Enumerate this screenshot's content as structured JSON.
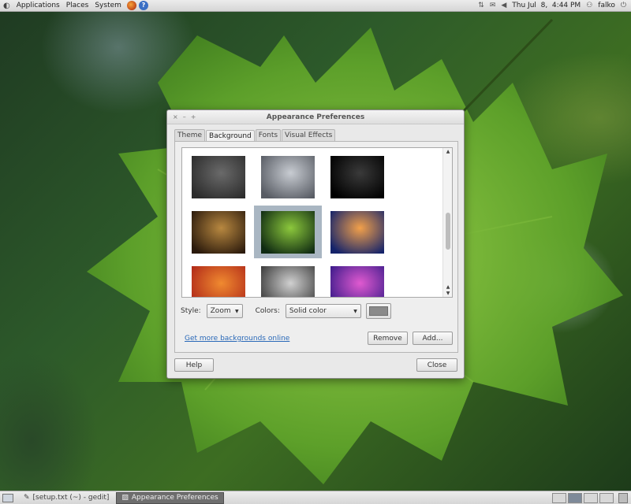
{
  "top_panel": {
    "menus": [
      "Applications",
      "Places",
      "System"
    ],
    "clock": "Thu Jul  8,  4:44 PM",
    "user": "falko",
    "icons": [
      "ubuntu-logo-icon",
      "firefox-icon",
      "help-icon",
      "network-icon",
      "mail-icon",
      "volume-icon",
      "power-icon"
    ]
  },
  "dialog": {
    "title": "Appearance Preferences",
    "window_buttons": [
      "×",
      "–",
      "+"
    ],
    "tabs": [
      "Theme",
      "Background",
      "Fonts",
      "Visual Effects"
    ],
    "active_tab": "Background",
    "backgrounds": [
      {
        "name": "dark-gray-wallpaper",
        "colors": [
          "#6a6a6a",
          "#2c2c2c"
        ]
      },
      {
        "name": "pebbles-wallpaper",
        "colors": [
          "#c8ccd2",
          "#585c64"
        ]
      },
      {
        "name": "white-flower-wallpaper",
        "colors": [
          "#3a3a3a",
          "#000000"
        ]
      },
      {
        "name": "autumn-leaves-wallpaper",
        "colors": [
          "#b88840",
          "#2b1a0c"
        ]
      },
      {
        "name": "green-leaf-wallpaper",
        "colors": [
          "#8cc83c",
          "#0f2a12"
        ],
        "selected": true
      },
      {
        "name": "pier-sunset-wallpaper",
        "colors": [
          "#f2a04a",
          "#14236a"
        ]
      },
      {
        "name": "orange-bokeh-wallpaper",
        "colors": [
          "#f08a30",
          "#b02818"
        ]
      },
      {
        "name": "gray-gradient-wallpaper",
        "colors": [
          "#d0d0d0",
          "#3a3a3a"
        ]
      },
      {
        "name": "purple-lights-wallpaper",
        "colors": [
          "#e05ad0",
          "#3a1a8a"
        ]
      }
    ],
    "style_label": "Style:",
    "style_value": "Zoom",
    "colors_label": "Colors:",
    "colors_value": "Solid color",
    "swatch_color": "#8a8a8a",
    "more_link": "Get more backgrounds online",
    "remove_button": "Remove",
    "add_button": "Add...",
    "help_button": "Help",
    "close_button": "Close"
  },
  "bottom_panel": {
    "tasks": [
      {
        "label": "[setup.txt (~) - gedit]",
        "active": false
      },
      {
        "label": "Appearance Preferences",
        "active": true
      }
    ],
    "workspaces": 4,
    "active_workspace": 1
  }
}
